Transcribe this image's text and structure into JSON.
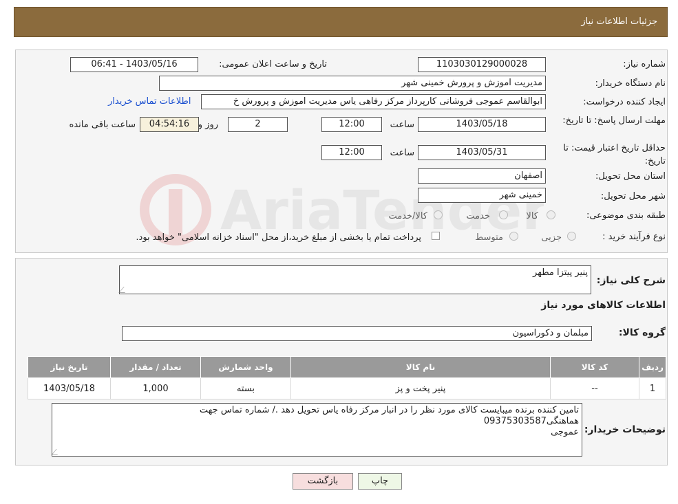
{
  "header": {
    "title": "جزئیات اطلاعات نیاز"
  },
  "form": {
    "need_number_label": "شماره نیاز:",
    "need_number": "1103030129000028",
    "announce_label": "تاریخ و ساعت اعلان عمومی:",
    "announce_value": "1403/05/16 - 06:41",
    "buyer_org_label": "نام دستگاه خریدار:",
    "buyer_org": "مدیریت اموزش و پرورش خمینی شهر",
    "creator_label": "ایجاد کننده درخواست:",
    "creator": "ابوالقاسم عموجی فروشانی کارپرداز مرکز رفاهی یاس مدیریت اموزش و پرورش خ",
    "contact_link": "اطلاعات تماس خریدار",
    "deadline_label": "مهلت ارسال پاسخ: تا تاریخ:",
    "deadline_date": "1403/05/18",
    "hour_label": "ساعت",
    "deadline_time": "12:00",
    "days_value": "2",
    "days_label": "روز و",
    "remaining_time": "04:54:16",
    "remaining_label": "ساعت باقی مانده",
    "min_validity_label": "حداقل تاریخ اعتبار قیمت: تا تاریخ:",
    "validity_date": "1403/05/31",
    "validity_time": "12:00",
    "province_label": "استان محل تحویل:",
    "province": "اصفهان",
    "city_label": "شهر محل تحویل:",
    "city": "خمینی شهر",
    "category_label": "طبقه بندی موضوعی:",
    "category_options": [
      "کالا",
      "خدمت",
      "کالا/خدمت"
    ],
    "process_label": "نوع فرآیند خرید :",
    "process_options": [
      "جزیی",
      "متوسط"
    ],
    "process_note": "پرداخت تمام یا بخشی از مبلغ خرید،از محل \"اسناد خزانه اسلامی\" خواهد بود."
  },
  "summary": {
    "desc_label": "شرح کلی نیاز:",
    "desc_value": "پنیر پیتزا مطهر",
    "items_title": "اطلاعات کالاهای مورد نیاز",
    "group_label": "گروه کالا:",
    "group_value": "مبلمان و دکوراسیون",
    "columns": [
      "ردیف",
      "کد کالا",
      "نام کالا",
      "واحد شمارش",
      "تعداد / مقدار",
      "تاریخ نیاز"
    ],
    "rows": [
      [
        "1",
        "--",
        "پنیر پخت و پز",
        "بسته",
        "1,000",
        "1403/05/18"
      ]
    ],
    "buyer_notes_label": "توضیحات خریدار:",
    "buyer_notes_line1": "تامین کننده برنده میبایست کالای مورد نظر را در انبار مرکز رفاه یاس تحویل دهد ./ شماره تماس جهت",
    "buyer_notes_line2": "هماهنگی09375303587",
    "buyer_notes_line3": "عموجی"
  },
  "buttons": {
    "print": "چاپ",
    "back": "بازگشت"
  },
  "watermark": {
    "text": "AriaTender.neT"
  },
  "colors": {
    "header_bg": "#8b6b3d",
    "link": "#1a4fd0",
    "table_header": "#9a9a9a",
    "back_button": "#f7dede"
  }
}
